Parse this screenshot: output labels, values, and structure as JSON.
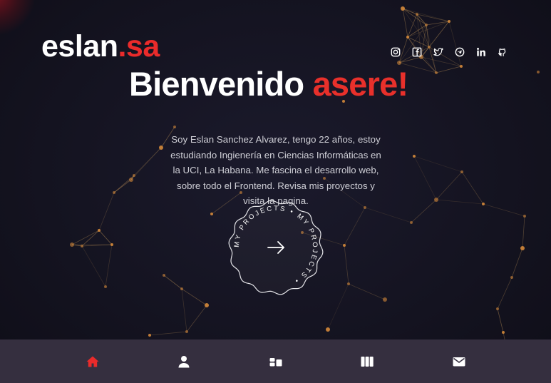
{
  "brand": {
    "name": "eslan",
    "suffix": ".sa"
  },
  "hero": {
    "greeting": "Bienvenido",
    "greeting_accent": "asere!",
    "intro": "Soy Eslan Sanchez Alvarez, tengo 22 años, estoy estudiando Ingienería en Ciencias Informáticas en la UCI, La Habana. Me fascina el desarrollo web, sobre todo el Frontend. Revisa mis proyectos y visita la pagina."
  },
  "projects_badge": {
    "ring_text": "MY PROJECTS • MY PROJECTS •",
    "icon": "arrow-right-icon"
  },
  "social_links": [
    {
      "name": "instagram",
      "icon": "instagram-icon"
    },
    {
      "name": "facebook",
      "icon": "facebook-icon"
    },
    {
      "name": "twitter",
      "icon": "twitter-icon"
    },
    {
      "name": "telegram",
      "icon": "telegram-icon"
    },
    {
      "name": "linkedin",
      "icon": "linkedin-icon"
    },
    {
      "name": "github",
      "icon": "github-icon"
    }
  ],
  "bottom_nav": [
    {
      "name": "home",
      "icon": "home-icon",
      "active": true
    },
    {
      "name": "about",
      "icon": "user-icon",
      "active": false
    },
    {
      "name": "skills",
      "icon": "blocks-icon",
      "active": false
    },
    {
      "name": "projects",
      "icon": "columns-icon",
      "active": false
    },
    {
      "name": "contact",
      "icon": "mail-icon",
      "active": false
    }
  ],
  "colors": {
    "accent": "#ea2b2b",
    "background": "#15131f",
    "nav_background": "#352f3f",
    "network_line": "#c89a5a",
    "network_node": "#d4883a",
    "text": "#ffffff",
    "muted_text": "#cfcfd6"
  }
}
